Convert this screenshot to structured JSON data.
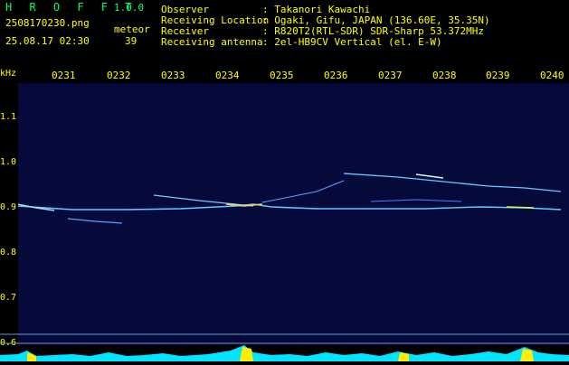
{
  "header": {
    "brand": "H R O F F T",
    "version": "1.0.0",
    "filename": "2508170230.png",
    "datetime": "25.08.17 02:30",
    "meteor_label": "meteor",
    "meteor_count": "39",
    "observer_label": "Observer",
    "observer_value": ": Takanori Kawachi",
    "location_label": "Receiving Location",
    "location_value": ": Ogaki, Gifu, JAPAN (136.60E, 35.35N)",
    "receiver_label": "Receiver",
    "receiver_value": ": R820T2(RTL-SDR) SDR-Sharp 53.372MHz",
    "antenna_label": "Receiving antenna",
    "antenna_value": ": 2el-HB9CV Vertical (el. E-W)"
  },
  "time_ticks": [
    "0231",
    "0232",
    "0233",
    "0234",
    "0235",
    "0236",
    "0237",
    "0238",
    "0239",
    "0240"
  ],
  "y_axis": {
    "unit": "kHz",
    "ticks": [
      "1.1",
      "1.0",
      "0.9",
      "0.8",
      "0.7",
      "0.6"
    ]
  },
  "colors": {
    "background": "#000000",
    "spectrogram_bg": "#050a3a",
    "label": "#ffff00",
    "brand": "#00ff66",
    "text": "#ffffff",
    "signal": "#66ccff",
    "level": "#00e5ff"
  }
}
